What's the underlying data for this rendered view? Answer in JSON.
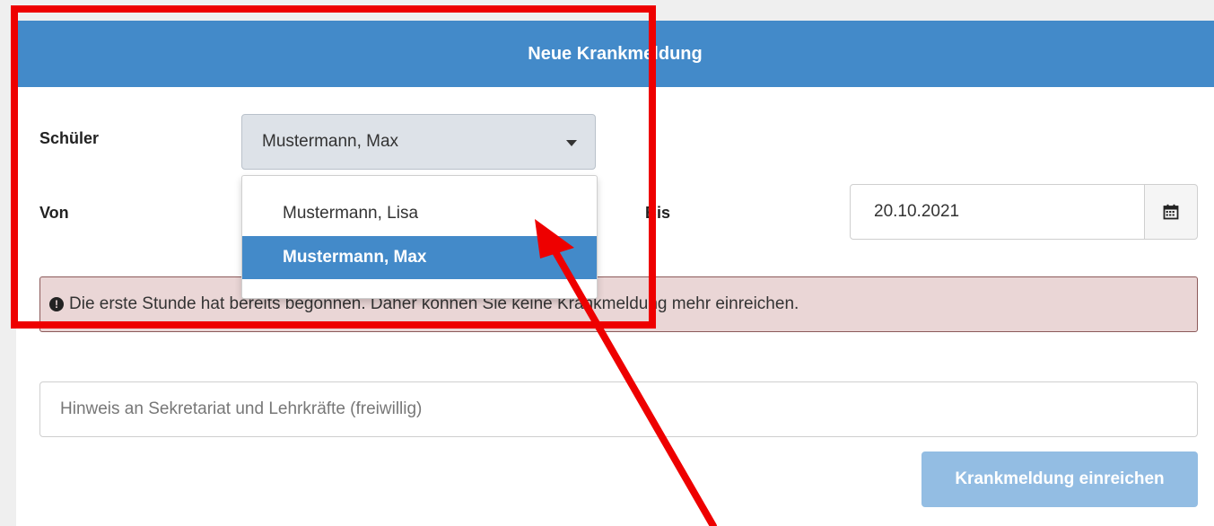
{
  "header": {
    "title": "Neue Krankmeldung"
  },
  "form": {
    "student_label": "Schüler",
    "student_selected": "Mustermann, Max",
    "from_label": "Von",
    "to_label": "Bis",
    "to_date": "20.10.2021",
    "dropdown_options": [
      "Mustermann, Lisa",
      "Mustermann, Max"
    ],
    "alert_text": "Die erste Stunde hat bereits begonnen. Daher können Sie keine Krankmeldung mehr einreichen.",
    "note_placeholder": "Hinweis an Sekretariat und Lehrkräfte (freiwillig)",
    "submit_label": "Krankmeldung einreichen"
  },
  "icons": {
    "caret": "caret-down-icon",
    "calendar": "calendar-icon",
    "alert": "exclamation-circle-icon"
  },
  "colors": {
    "primary": "#438ac9",
    "submit_disabled": "#93bde3",
    "alert_bg": "#ead6d6",
    "annotation": "#ee0000"
  }
}
